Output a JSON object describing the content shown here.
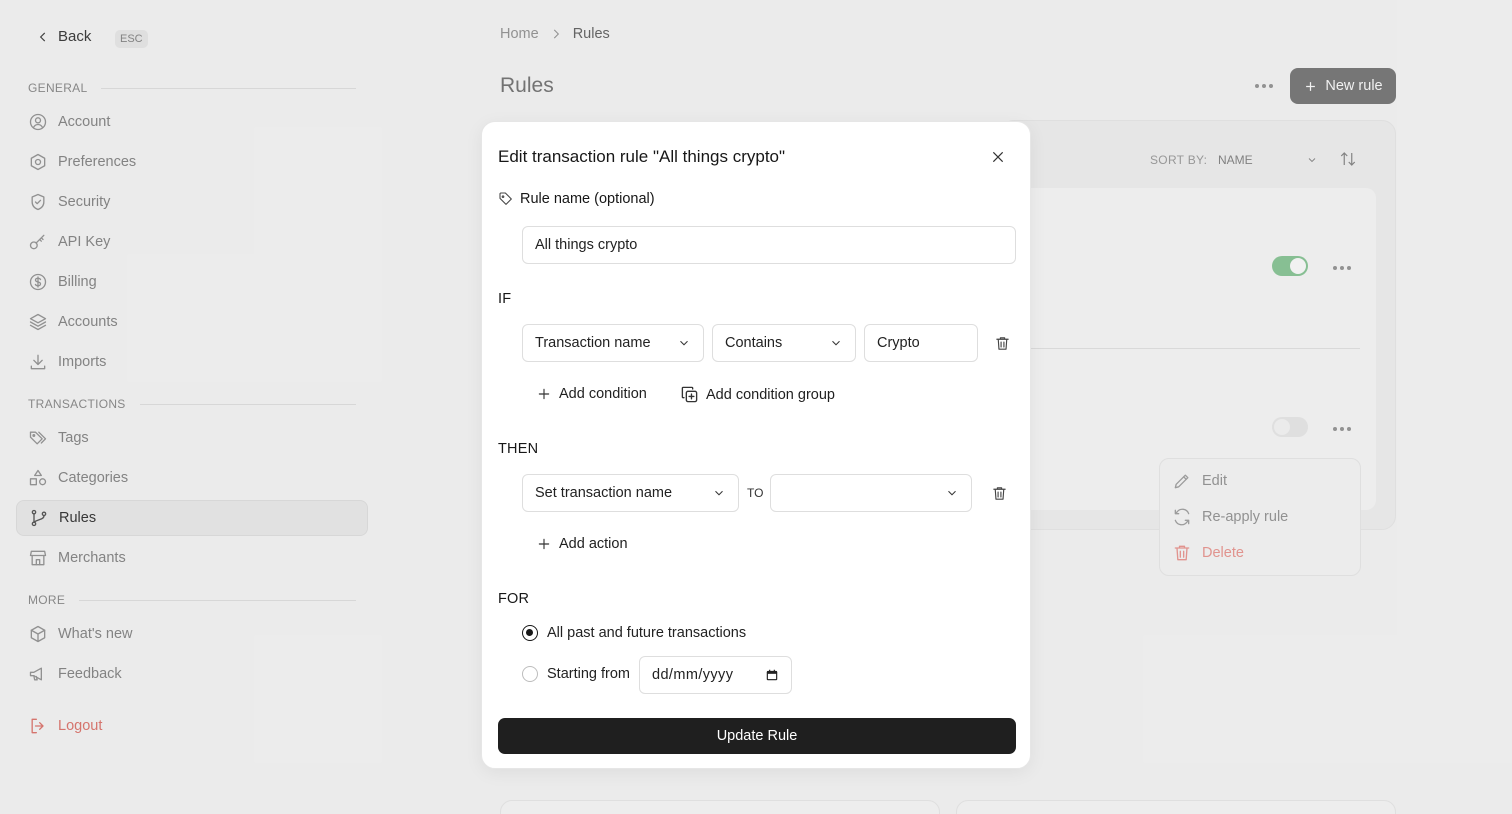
{
  "sidebar": {
    "back_label": "Back",
    "esc_label": "ESC",
    "sections": {
      "general": "GENERAL",
      "transactions": "TRANSACTIONS",
      "more": "MORE"
    },
    "items": {
      "account": "Account",
      "preferences": "Preferences",
      "security": "Security",
      "api_key": "API Key",
      "billing": "Billing",
      "accounts": "Accounts",
      "imports": "Imports",
      "tags": "Tags",
      "categories": "Categories",
      "rules": "Rules",
      "merchants": "Merchants",
      "whats_new": "What's new",
      "feedback": "Feedback",
      "logout": "Logout"
    },
    "active_item": "rules"
  },
  "header": {
    "breadcrumb": [
      "Home",
      "Rules"
    ],
    "title": "Rules",
    "new_rule_label": "New rule"
  },
  "rules_list": {
    "sort_label": "SORT BY:",
    "sort_value": "NAME",
    "rows": [
      {
        "enabled": true
      },
      {
        "enabled": false
      }
    ]
  },
  "context_menu": {
    "items": [
      "Edit",
      "Re-apply rule",
      "Delete"
    ]
  },
  "modal": {
    "title": "Edit transaction rule \"All things crypto\"",
    "rule_name_label": "Rule name (optional)",
    "rule_name_value": "All things crypto",
    "if_label": "IF",
    "condition": {
      "field": "Transaction name",
      "operator": "Contains",
      "value": "Crypto"
    },
    "add_condition_label": "Add condition",
    "add_condition_group_label": "Add condition group",
    "then_label": "THEN",
    "action": {
      "type": "Set transaction name",
      "to_label": "TO",
      "value": ""
    },
    "add_action_label": "Add action",
    "for_label": "FOR",
    "options": {
      "all": "All past and future transactions",
      "starting_from": "Starting from"
    },
    "selected_option": "all",
    "date_placeholder": "dd/mm/yyyy",
    "submit_label": "Update Rule"
  },
  "colors": {
    "primary": "#1f1f1f",
    "toggle_on": "#8fca9c",
    "danger": "#e27b73"
  }
}
